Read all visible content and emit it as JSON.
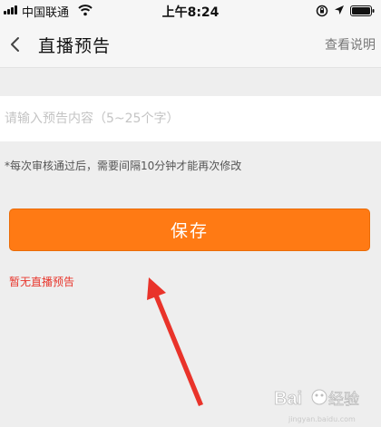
{
  "status_bar": {
    "carrier": "中国联通",
    "time": "上午8:24",
    "icons": [
      "signal-icon",
      "wifi-icon",
      "rotation-lock-icon",
      "location-icon",
      "battery-icon"
    ]
  },
  "nav": {
    "title": "直播预告",
    "action": "查看说明",
    "back_icon": "chevron-left-icon"
  },
  "form": {
    "input_value": "",
    "input_placeholder": "请输入预告内容（5~25个字）",
    "hint": "*每次审核通过后，需要间隔10分钟才能再次修改",
    "save_label": "保存"
  },
  "empty_notice": "暂无直播预告",
  "colors": {
    "accent": "#ff7a14",
    "notice_red": "#e8362c",
    "annotation_red": "#e9332a",
    "background": "#eeeeee"
  },
  "watermark": {
    "logo": "Bai du 经验",
    "url": "jingyan.baidu.com"
  }
}
